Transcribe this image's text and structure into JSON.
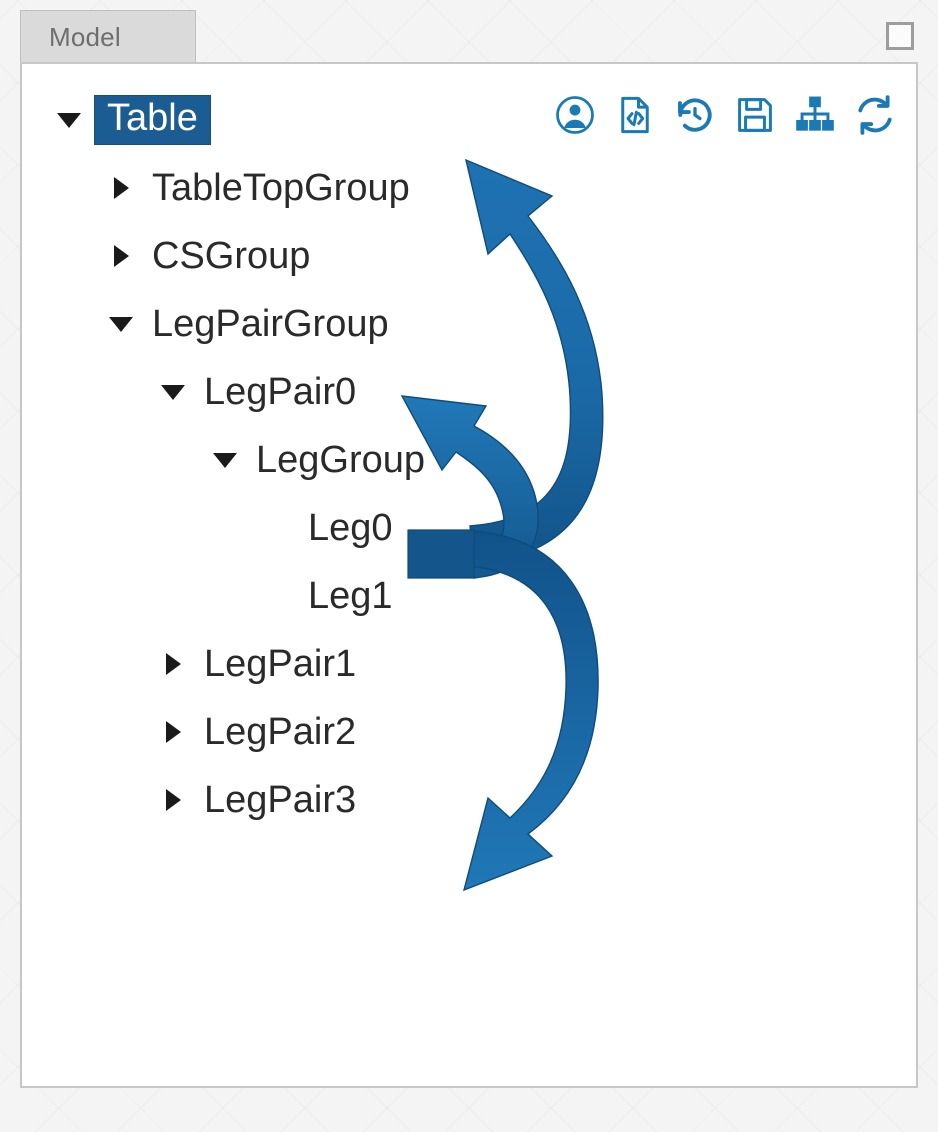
{
  "window": {
    "restore_button_label": "",
    "restore_icon": "maximize-square-icon"
  },
  "tabs": [
    {
      "label": "Model",
      "active": true
    }
  ],
  "toolbar": {
    "buttons": [
      {
        "icon": "user-circle-icon",
        "label": "User"
      },
      {
        "icon": "code-document-icon",
        "label": "Code Document"
      },
      {
        "icon": "history-restore-icon",
        "label": "History"
      },
      {
        "icon": "save-floppy-icon",
        "label": "Save"
      },
      {
        "icon": "hierarchy-tree-icon",
        "label": "Hierarchy"
      },
      {
        "icon": "refresh-sync-icon",
        "label": "Refresh"
      }
    ]
  },
  "tree": {
    "nodes": [
      {
        "label": "Table",
        "depth": 0,
        "state": "expanded",
        "selected": true
      },
      {
        "label": "TableTopGroup",
        "depth": 1,
        "state": "collapsed",
        "selected": false
      },
      {
        "label": "CSGroup",
        "depth": 1,
        "state": "collapsed",
        "selected": false
      },
      {
        "label": "LegPairGroup",
        "depth": 1,
        "state": "expanded",
        "selected": false
      },
      {
        "label": "LegPair0",
        "depth": 2,
        "state": "expanded",
        "selected": false
      },
      {
        "label": "LegGroup",
        "depth": 3,
        "state": "expanded",
        "selected": false
      },
      {
        "label": "Leg0",
        "depth": 4,
        "state": "leaf",
        "selected": false
      },
      {
        "label": "Leg1",
        "depth": 4,
        "state": "leaf",
        "selected": false
      },
      {
        "label": "LegPair1",
        "depth": 2,
        "state": "collapsed",
        "selected": false
      },
      {
        "label": "LegPair2",
        "depth": 2,
        "state": "collapsed",
        "selected": false
      },
      {
        "label": "LegPair3",
        "depth": 2,
        "state": "collapsed",
        "selected": false
      }
    ]
  },
  "annotations": {
    "arrows": [
      {
        "name": "arrow-to-tabletopgroup",
        "from": "LegGroup",
        "to": "TableTopGroup"
      },
      {
        "name": "arrow-to-legpairgroup",
        "from": "LegGroup",
        "to": "LegPairGroup"
      },
      {
        "name": "arrow-to-legpair1",
        "from": "LegGroup",
        "to": "LegPair1"
      }
    ]
  },
  "colors": {
    "accent": "#1b6fb0",
    "accent_dark": "#12548a",
    "selection": "#1b5d92",
    "icon": "#1b7ab5",
    "panel_border": "#c7c7c7",
    "tab_active": "#dadada"
  }
}
